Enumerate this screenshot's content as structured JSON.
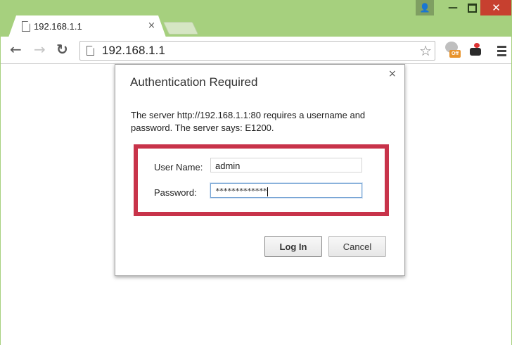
{
  "tab": {
    "title": "192.168.1.1",
    "close_glyph": "×"
  },
  "window_controls": {
    "user_glyph": "👤",
    "min_glyph": "—",
    "close_glyph": "✕"
  },
  "toolbar": {
    "back_glyph": "←",
    "forward_glyph": "→",
    "reload_glyph": "↻",
    "url": "192.168.1.1",
    "star_glyph": "☆",
    "extension_badge": "Off"
  },
  "dialog": {
    "title": "Authentication Required",
    "close_glyph": "×",
    "message": "The server http://192.168.1.1:80 requires a username and password. The server says: E1200.",
    "username_label": "User Name:",
    "username_value": "admin",
    "password_label": "Password:",
    "password_value": "*************",
    "login_label": "Log In",
    "cancel_label": "Cancel"
  },
  "colors": {
    "frame": "#a6d07e",
    "highlight_border": "#c8334a",
    "close_button": "#c7402f"
  },
  "icons": [
    "page-icon",
    "user-icon",
    "minimize-icon",
    "maximize-icon",
    "close-icon",
    "back-arrow-icon",
    "forward-arrow-icon",
    "reload-icon",
    "bookmark-star-icon",
    "extension-icon",
    "camera-extension-icon",
    "menu-icon"
  ]
}
